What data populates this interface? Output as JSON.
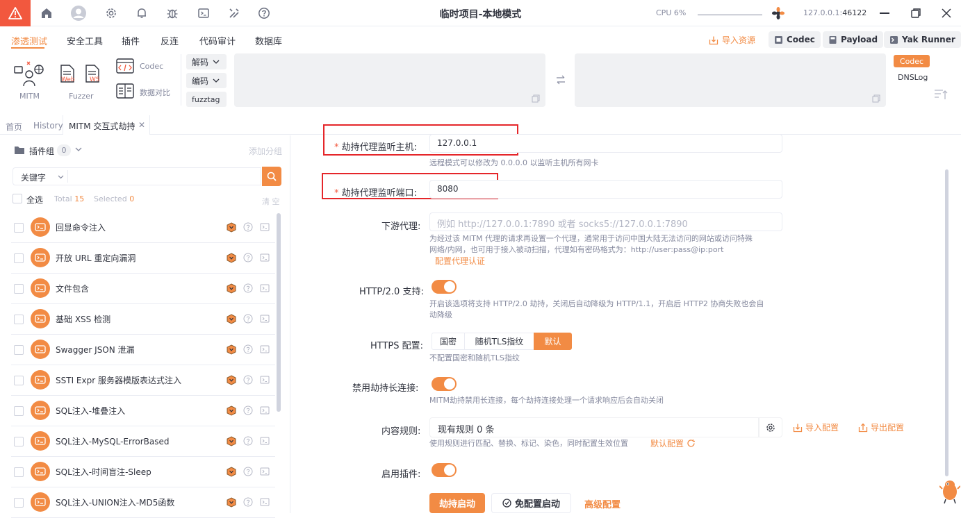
{
  "window": {
    "title": "临时项目-本地模式",
    "cpu_label": "CPU 6%",
    "address_host": "127.0.0.1",
    "address_port": "46122"
  },
  "menu": {
    "items": [
      "渗透测试",
      "安全工具",
      "插件",
      "反连",
      "代码审计",
      "数据库"
    ],
    "import_resource": "导入资源",
    "codec_btn": "Codec",
    "payload_btn": "Payload",
    "yakrunner_btn": "Yak Runner"
  },
  "toolbar": {
    "mitm": "MITM",
    "fuzzer": "Fuzzer",
    "web": "Web",
    "ws": "WS",
    "codec": "Codec",
    "data_compare": "数据对比",
    "decode": "解码",
    "encode": "编码",
    "fuzztag": "fuzztag",
    "codec_tag": "Codec",
    "dnslog": "DNSLog"
  },
  "tabs": {
    "home": "首页",
    "history": "History",
    "mitm": "MITM 交互式劫持"
  },
  "plugins": {
    "group_label": "插件组",
    "group_count": "0",
    "add_group": "添加分组",
    "keyword": "关键字",
    "select_all": "全选",
    "total_label": "Total",
    "total": "15",
    "selected_label": "Selected",
    "selected": "0",
    "clear": "清 空",
    "items": [
      "回显命令注入",
      "开放 URL 重定向漏洞",
      "文件包含",
      "基础 XSS 检测",
      "Swagger JSON 泄漏",
      "SSTI Expr 服务器模版表达式注入",
      "SQL注入-堆叠注入",
      "SQL注入-MySQL-ErrorBased",
      "SQL注入-时间盲注-Sleep",
      "SQL注入-UNION注入-MD5函数"
    ]
  },
  "form": {
    "host_label": "劫持代理监听主机:",
    "host_value": "127.0.0.1",
    "host_help": "远程模式可以修改为 0.0.0.0 以监听主机所有网卡",
    "port_label": "劫持代理监听端口:",
    "port_value": "8080",
    "downstream_label": "下游代理:",
    "downstream_placeholder": "例如 http://127.0.0.1:7890 或者 socks5://127.0.0.1:7890",
    "downstream_help_1": "为经过该 MITM 代理的请求再设置一个代理，通常用于访问中国大陆无法访问的网站或访问特殊",
    "downstream_help_2": "网络/内网，也可用于接入被动扫描，代理如有密码格式为：http://user:pass@ip:port",
    "proxy_auth_link": "配置代理认证",
    "http2_label": "HTTP/2.0 支持:",
    "http2_help_1": "开启该选项将支持 HTTP/2.0 劫持，关闭后自动降级为 HTTP/1.1，开启后 HTTP2 协商失败也会自",
    "http2_help_2": "动降级",
    "http2_on": true,
    "https_label": "HTTPS 配置:",
    "https_options": [
      "国密",
      "随机TLS指纹",
      "默认"
    ],
    "https_selected": "默认",
    "https_help": "不配置国密和随机TLS指纹",
    "keepalive_label": "禁用劫持长连接:",
    "keepalive_help": "MITM劫持禁用长连接，每个劫持连接处理一个请求响应后会自动关闭",
    "keepalive_on": true,
    "rules_label": "内容规则:",
    "rules_value": "现有规则 0 条",
    "import_config": "导入配置",
    "export_config": "导出配置",
    "rules_help": "使用规则进行匹配、替换、标记、染色，同时配置生效位置",
    "default_config": "默认配置",
    "plugin_label": "启用插件:",
    "plugin_on": true,
    "start_btn": "劫持启动",
    "free_start_btn": "免配置启动",
    "advanced_btn": "高级配置"
  },
  "colors": {
    "accent": "#f28b44",
    "warn": "#f2583e",
    "highlight_box": "#e5262a"
  }
}
